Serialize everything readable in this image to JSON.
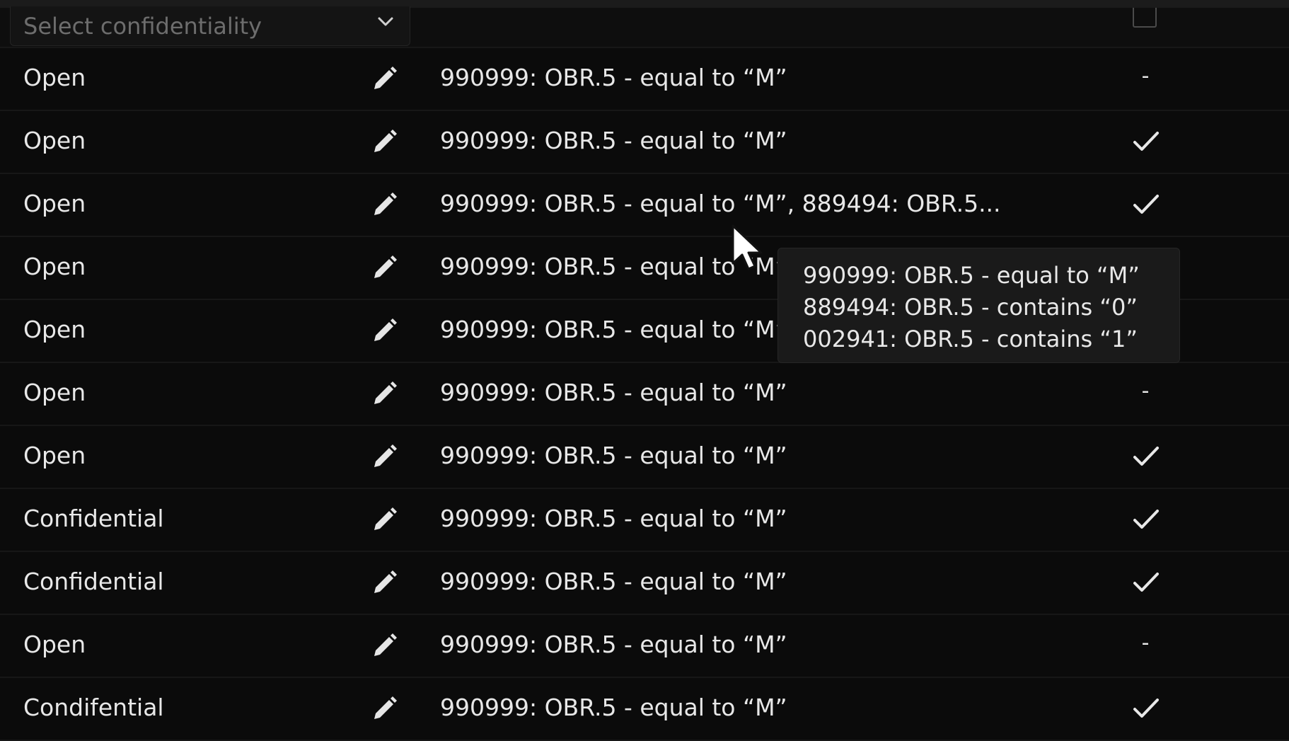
{
  "filter": {
    "select_placeholder": "Select confidentiality"
  },
  "rows": [
    {
      "confidentiality": "Open",
      "rule": "990999: OBR.5 - equal to “M”",
      "status": "-"
    },
    {
      "confidentiality": "Open",
      "rule": "990999: OBR.5 - equal to “M”",
      "status": "check"
    },
    {
      "confidentiality": "Open",
      "rule": "990999: OBR.5 - equal to “M”, 889494: OBR.5...",
      "status": "check"
    },
    {
      "confidentiality": "Open",
      "rule": "990999: OBR.5 - equal to “M”",
      "status": "hidden"
    },
    {
      "confidentiality": "Open",
      "rule": "990999: OBR.5 - equal to “M”",
      "status": "hidden"
    },
    {
      "confidentiality": "Open",
      "rule": "990999: OBR.5 - equal to “M”",
      "status": "-"
    },
    {
      "confidentiality": "Open",
      "rule": "990999: OBR.5 - equal to “M”",
      "status": "check"
    },
    {
      "confidentiality": "Confidential",
      "rule": "990999: OBR.5 - equal to “M”",
      "status": "check"
    },
    {
      "confidentiality": "Confidential",
      "rule": "990999: OBR.5 - equal to “M”",
      "status": "check"
    },
    {
      "confidentiality": "Open",
      "rule": "990999: OBR.5 - equal to “M”",
      "status": "-"
    },
    {
      "confidentiality": "Condifential",
      "rule": "990999: OBR.5 - equal to “M”",
      "status": "check"
    }
  ],
  "tooltip": {
    "lines": [
      "990999: OBR.5 - equal to “M”",
      "889494: OBR.5 - contains “0”",
      "002941: OBR.5 - contains “1”"
    ]
  },
  "icons": {
    "edit": "pencil-icon",
    "check": "checkmark-icon",
    "dropdown": "chevron-down-icon",
    "cursor": "mouse-pointer-icon"
  }
}
